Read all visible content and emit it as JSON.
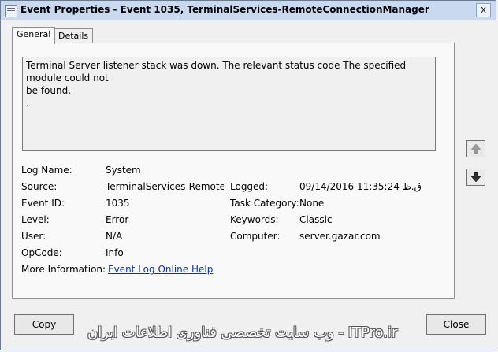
{
  "window": {
    "title": "Event Properties - Event 1035, TerminalServices-RemoteConnectionManager",
    "close_glyph": "x"
  },
  "tabs": [
    {
      "label": "General",
      "active": true
    },
    {
      "label": "Details",
      "active": false
    }
  ],
  "message": {
    "line1": "Terminal Server listener stack was down. The relevant status code The specified module could not",
    "line2": "be found.",
    "line3": "."
  },
  "fields": {
    "log_name": {
      "label": "Log Name:",
      "value": "System"
    },
    "source": {
      "label": "Source:",
      "value": "TerminalServices-RemoteCo"
    },
    "logged": {
      "label": "Logged:",
      "value": "09/14/2016 11:35:24 ق.ظ"
    },
    "event_id": {
      "label": "Event ID:",
      "value": "1035"
    },
    "task_category": {
      "label": "Task Category:",
      "value": "None"
    },
    "level": {
      "label": "Level:",
      "value": "Error"
    },
    "keywords": {
      "label": "Keywords:",
      "value": "Classic"
    },
    "user": {
      "label": "User:",
      "value": "N/A"
    },
    "computer": {
      "label": "Computer:",
      "value": "server.gazar.com"
    },
    "opcode": {
      "label": "OpCode:",
      "value": "Info"
    },
    "more_info": {
      "label": "More Information:",
      "value": "Event Log Online Help"
    }
  },
  "buttons": {
    "copy": "Copy",
    "close": "Close"
  },
  "watermark": "ITPro.ir - وب سایت تخصصی فناوری اطلاعات ایران",
  "colors": {
    "titlebar": "#c9d9ef",
    "link": "#0033cc",
    "background": "#f0f0f0"
  }
}
